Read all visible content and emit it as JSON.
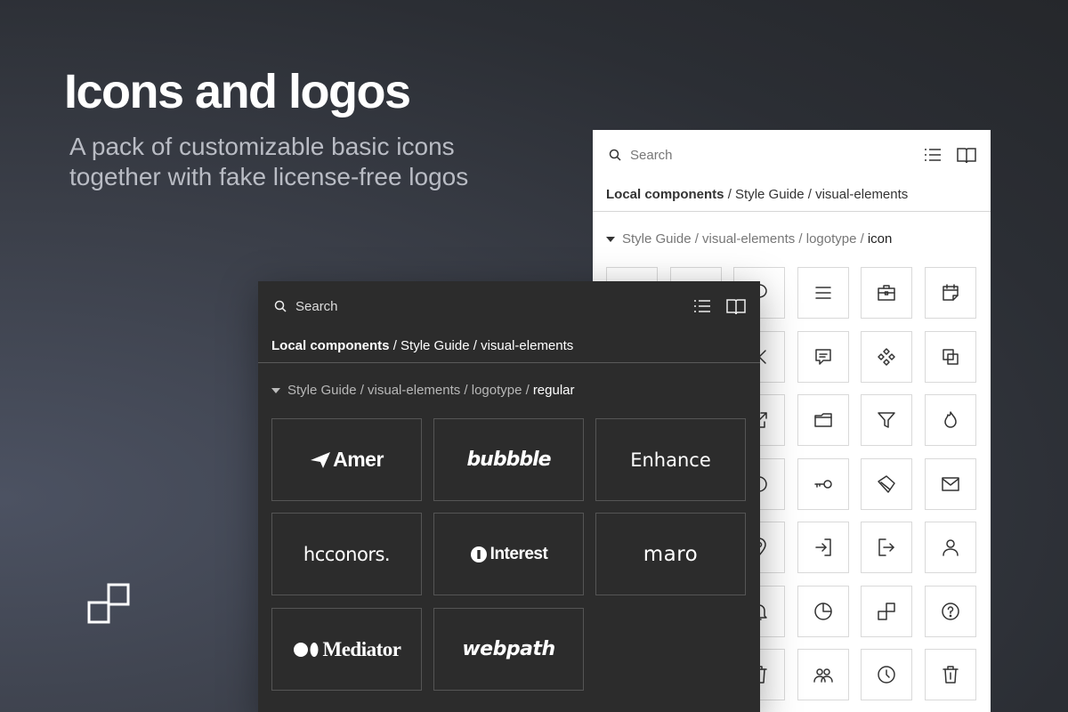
{
  "hero": {
    "title": "Icons and logos",
    "subtitle": "A pack of customizable basic icons together with fake license-free logos"
  },
  "light_panel": {
    "search_placeholder": "Search",
    "breadcrumb_bold": "Local components",
    "breadcrumb_rest": " / Style Guide / visual-elements",
    "section_path": "Style Guide / visual-elements / logotype /",
    "section_current": "icon",
    "icons": [
      "blank-icon",
      "blank-icon",
      "chat-bubble-icon",
      "menu-icon",
      "briefcase-icon",
      "calendar-icon",
      "blank-icon",
      "blank-icon",
      "close-icon",
      "message-icon",
      "component-icon",
      "copy-icon",
      "blank-icon",
      "blank-icon",
      "external-link-icon",
      "folder-icon",
      "filter-icon",
      "flame-icon",
      "blank-icon",
      "blank-icon",
      "circle-icon",
      "key-icon",
      "diamond-icon",
      "mail-icon",
      "blank-icon",
      "blank-icon",
      "location-icon",
      "login-icon",
      "logout-icon",
      "user-icon",
      "blank-icon",
      "blank-icon",
      "bell-icon",
      "pie-chart-icon",
      "logo-mark-icon",
      "help-icon",
      "blank-icon",
      "blank-icon",
      "trash-icon",
      "users-icon",
      "clock-icon",
      "trash-icon"
    ]
  },
  "dark_panel": {
    "search_placeholder": "Search",
    "breadcrumb_bold": "Local components",
    "breadcrumb_rest": " / Style Guide / visual-elements",
    "section_path": "Style Guide / visual-elements / logotype /",
    "section_current": "regular",
    "logos": [
      {
        "id": "amer",
        "label": "Amer"
      },
      {
        "id": "bubbble",
        "label": "bubbble"
      },
      {
        "id": "enhance",
        "label": "Enhance"
      },
      {
        "id": "hcconors",
        "label": "hcconors."
      },
      {
        "id": "interest",
        "label": "Interest"
      },
      {
        "id": "maro",
        "label": "maro"
      },
      {
        "id": "mediator",
        "label": "Mediator"
      },
      {
        "id": "webpath",
        "label": "webpath"
      }
    ]
  },
  "colors": {
    "dark_panel_bg": "#2c2c2c",
    "light_panel_bg": "#ffffff",
    "subtitle": "#b9bcc4"
  }
}
